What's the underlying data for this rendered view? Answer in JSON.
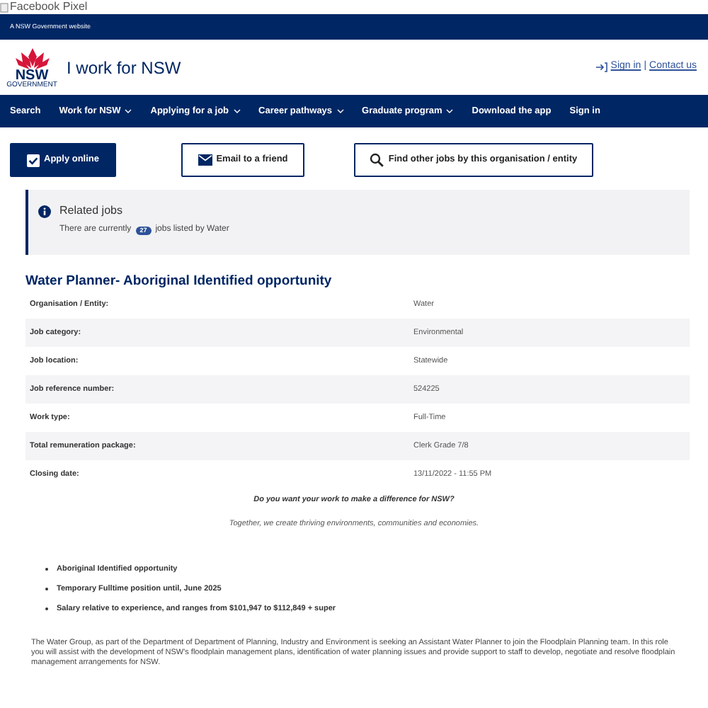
{
  "broken_image": {
    "alt": "Facebook Pixel"
  },
  "masthead": {
    "text": "A NSW Government website"
  },
  "header": {
    "logo_text": "NSW",
    "logo_subtext": "GOVERNMENT",
    "title": "I work for NSW",
    "links": [
      "Sign in",
      "Contact us"
    ],
    "separator": "|"
  },
  "nav": [
    {
      "label": "Search",
      "has_menu": false
    },
    {
      "label": "Work for NSW",
      "has_menu": true
    },
    {
      "label": "Applying for a job",
      "has_menu": true
    },
    {
      "label": "Career pathways",
      "has_menu": true
    },
    {
      "label": "Graduate program",
      "has_menu": true
    },
    {
      "label": "Download the app",
      "has_menu": false
    },
    {
      "label": "Sign in",
      "has_menu": false
    }
  ],
  "actions": [
    {
      "label": "Apply online",
      "kind": "primary"
    },
    {
      "label": "Email to a friend",
      "kind": "email"
    },
    {
      "label": "Find other jobs by this organisation / entity",
      "kind": "search"
    }
  ],
  "related": {
    "title": "Related jobs",
    "text_before": "There are currently",
    "count": "27",
    "text_after": "jobs listed by Water"
  },
  "job": {
    "title": "Water Planner- Aboriginal Identified opportunity",
    "details": [
      {
        "label": "Organisation / Entity:",
        "value": "Water"
      },
      {
        "label": "Job category:",
        "value": "Environmental"
      },
      {
        "label": "Job location:",
        "value": "Statewide"
      },
      {
        "label": "Job reference number:",
        "value": "524225"
      },
      {
        "label": "Work type:",
        "value": "Full-Time"
      },
      {
        "label": "Total remuneration package:",
        "value": "Clerk Grade 7/8"
      },
      {
        "label": "Closing date:",
        "value": "13/11/2022 - 11:55 PM"
      }
    ]
  },
  "intro": {
    "question": "Do you want your work to make a difference for NSW?",
    "tagline": "Together, we create thriving environments, communities and economies."
  },
  "highlights": [
    "Aboriginal Identified opportunity",
    "Temporary Fulltime position until, June 2025",
    "Salary relative to experience, and ranges from $101,947 to $112,849 + super"
  ],
  "description": "The Water Group, as part of the Department of Department of Planning, Industry and Environment is seeking an Assistant Water Planner to join the Floodplain Planning team. In this role you will assist with the development of NSW's floodplain management plans, identification of water planning issues and provide support to staff to develop, negotiate and resolve floodplain management arrangements for NSW."
}
